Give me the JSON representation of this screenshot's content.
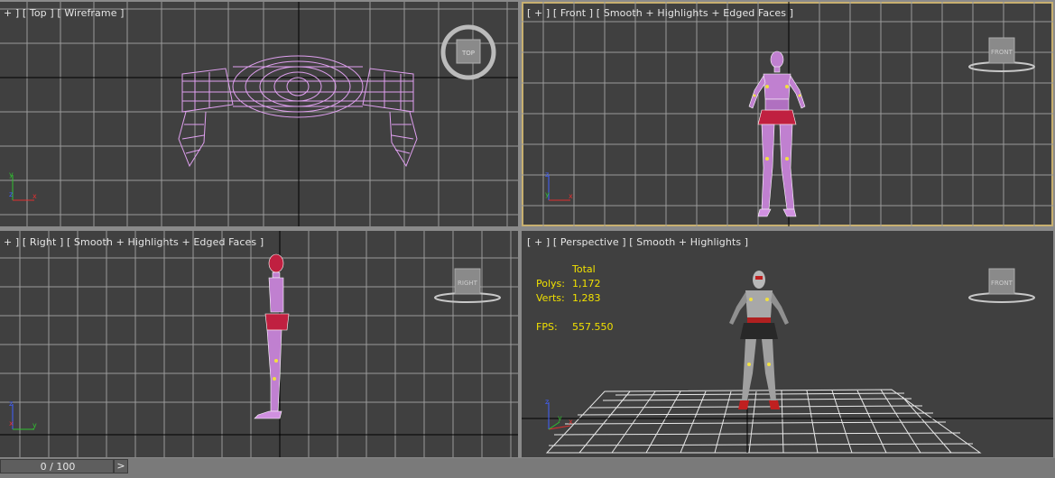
{
  "viewports": {
    "top": {
      "label": "+ ] [ Top ] [ Wireframe ]",
      "cube_label": "TOP"
    },
    "front": {
      "label": "[ + ] [ Front ] [ Smooth + Highlights + Edged Faces ]",
      "cube_label": "FRONT"
    },
    "right": {
      "label": "+ ] [ Right ] [ Smooth + Highlights + Edged Faces ]",
      "cube_label": "RIGHT"
    },
    "perspective": {
      "label": "[ + ] [ Perspective ] [ Smooth + Highlights ]",
      "cube_label": "FRONT",
      "stats": {
        "header": "Total",
        "polys_label": "Polys:",
        "polys_value": "1,172",
        "verts_label": "Verts:",
        "verts_value": "1,283",
        "fps_label": "FPS:",
        "fps_value": "557.550"
      }
    }
  },
  "active_viewport": "front",
  "timeline": {
    "frame_text": "0 / 100",
    "next_label": ">"
  },
  "colors": {
    "viewport_bg": "#404040",
    "grid": "#9a9a9a",
    "wireframe": "#e0a0f0",
    "active_border": "#c8b070",
    "stats_text": "#f0e000"
  },
  "icons": {
    "axis_gizmo": "axis-tripod-icon",
    "view_cube": "view-cube-icon",
    "next_frame": "chevron-right-icon"
  }
}
